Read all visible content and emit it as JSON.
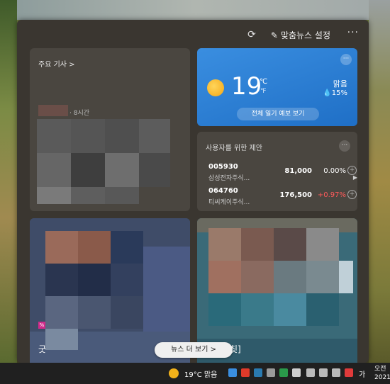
{
  "header": {
    "settings_label": "맞춤뉴스 설정",
    "more_label": "···"
  },
  "top_news": {
    "heading": "주요 기사 >",
    "time": "· 8시간"
  },
  "weather": {
    "temperature": "19",
    "unit_c": "℃",
    "unit_f": "℉",
    "condition": "맑음",
    "humidity": "💧15%",
    "forecast_button": "전체 일기 예보 보기",
    "more_label": "···"
  },
  "suggestions": {
    "heading": "사용자를 위한 제안",
    "more_label": "···",
    "stocks": [
      {
        "code": "005930",
        "name": "삼성전자주식...",
        "price": "81,000",
        "change": "0.00%",
        "change_color": "#ffffff"
      },
      {
        "code": "064760",
        "name": "티씨케이주식...",
        "price": "176,500",
        "change": "+0.97%",
        "change_color": "#ff5a5a"
      }
    ]
  },
  "news_cards": [
    {
      "title": "굿",
      "tag": "%"
    },
    {
      "title": "칫]"
    }
  ],
  "more_news_button": "뉴스 더 보기 >",
  "taskbar": {
    "weather": "19°C  맑음",
    "lang": "가",
    "time": "오전",
    "date": "2021-"
  }
}
